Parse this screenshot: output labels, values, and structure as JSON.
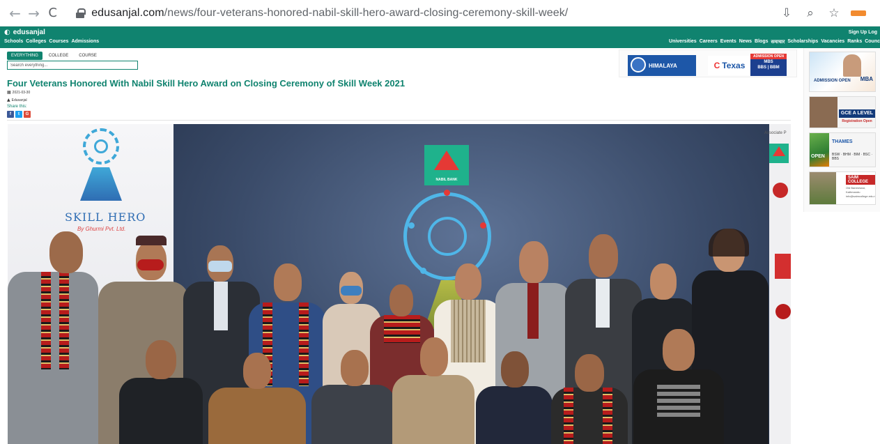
{
  "browser": {
    "url_domain": "edusanjal.com",
    "url_path": "/news/four-veterans-honored-nabil-skill-hero-award-closing-ceremony-skill-week/",
    "back_glyph": "←",
    "forward_glyph": "→",
    "reload_glyph": "C",
    "install_glyph": "⇩",
    "zoom_glyph": "⌕",
    "star_glyph": "☆"
  },
  "site": {
    "brand": "edusanjal",
    "brand_icon": "◐",
    "nav_left": [
      "Schools",
      "Colleges",
      "Courses",
      "Admissions"
    ],
    "nav_right": [
      "Universities",
      "Careers",
      "Events",
      "News",
      "Blogs",
      "समाचार",
      "Scholarships",
      "Vacancies",
      "Ranks",
      "Counc"
    ],
    "signup": "Sign Up",
    "login": "Log"
  },
  "search": {
    "tabs": [
      "EVERYTHING",
      "COLLEGE",
      "COURSE"
    ],
    "placeholder": "Search everything..."
  },
  "top_ad": {
    "himalaya": "HIMALAYA",
    "himalaya_sub": "COLLEGE OF ENGINEERING",
    "texas": "Texas",
    "texas_c": "C",
    "admission_open": "ADMISSION OPEN",
    "mbs": "MBS",
    "bbs": "BBS | BBM"
  },
  "side_ads": {
    "ad1_mba": "MBA",
    "ad1_admission": "ADMISSION OPEN",
    "ad2_gce": "GCE A LEVEL",
    "ad2_reg": "Registration Open",
    "ad3_open": "OPEN",
    "ad3_thames": "THAMES",
    "ad3_programs": "BSW · BHM · BIM · BSC · BBS",
    "ad4_saim": "SAIM COLLEGE",
    "ad4_addr": "Old Baneshwor, Kathmandu info@saimcollege.edu.np"
  },
  "article": {
    "title": "Four Veterans Honored With Nabil Skill Hero Award on Closing Ceremony of Skill Week 2021",
    "date": "2021-03-30",
    "author": "Edusanjal",
    "share_label": "Share this:",
    "share_buttons": [
      "f",
      "t",
      "G"
    ],
    "calendar_icon": "▦",
    "user_icon": "▲"
  },
  "photo": {
    "skill_hero_text": "SKILL HERO",
    "skill_hero_sub": "By Ghurmi Pvt. Ltd.",
    "nabil_text": "NABIL BANK",
    "right_banner_text": "Associate P"
  }
}
